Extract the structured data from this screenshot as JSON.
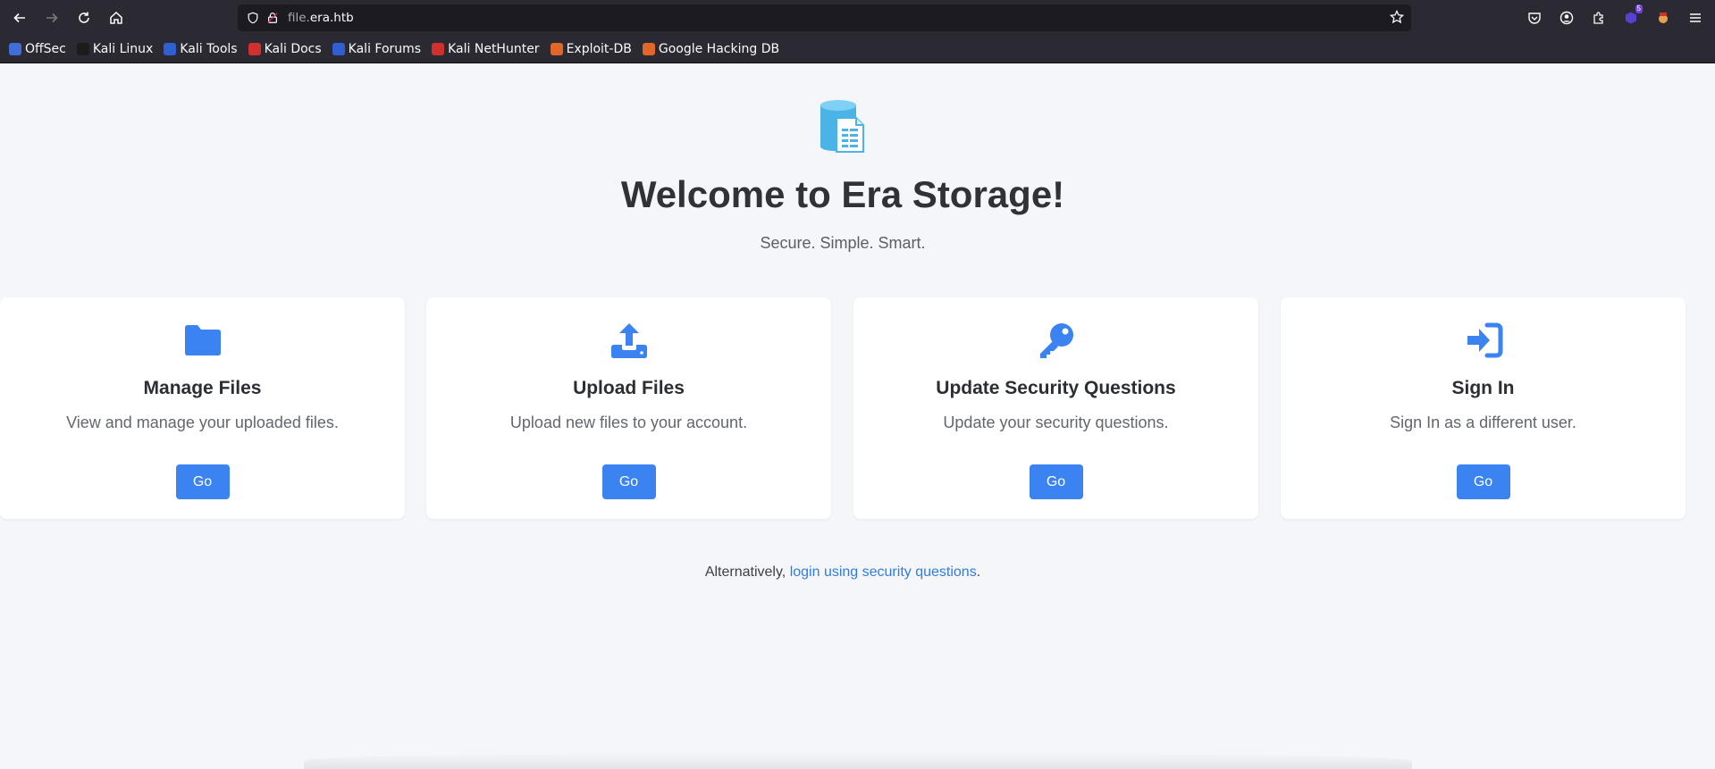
{
  "browser": {
    "url_prefix": "file.",
    "url_domain": "era.htb",
    "extension_badge": "5",
    "bookmarks": [
      {
        "label": "OffSec",
        "color": "#3f6fd6"
      },
      {
        "label": "Kali Linux",
        "color": "#1c1c1c"
      },
      {
        "label": "Kali Tools",
        "color": "#2f5fd0"
      },
      {
        "label": "Kali Docs",
        "color": "#d0312d"
      },
      {
        "label": "Kali Forums",
        "color": "#2f5fd0"
      },
      {
        "label": "Kali NetHunter",
        "color": "#d0312d"
      },
      {
        "label": "Exploit-DB",
        "color": "#e0662a"
      },
      {
        "label": "Google Hacking DB",
        "color": "#e0662a"
      }
    ]
  },
  "page": {
    "title": "Welcome to Era Storage!",
    "tagline": "Secure. Simple. Smart.",
    "accent_color": "#3a83f1",
    "cards": [
      {
        "icon": "folder-icon",
        "title": "Manage Files",
        "description": "View and manage your uploaded files.",
        "button": "Go"
      },
      {
        "icon": "upload-icon",
        "title": "Upload Files",
        "description": "Upload new files to your account.",
        "button": "Go"
      },
      {
        "icon": "key-icon",
        "title": "Update Security Questions",
        "description": "Update your security questions.",
        "button": "Go"
      },
      {
        "icon": "sign-in-icon",
        "title": "Sign In",
        "description": "Sign In as a different user.",
        "button": "Go"
      }
    ],
    "alternative_prefix": "Alternatively, ",
    "alternative_link": "login using security questions",
    "alternative_suffix": "."
  }
}
